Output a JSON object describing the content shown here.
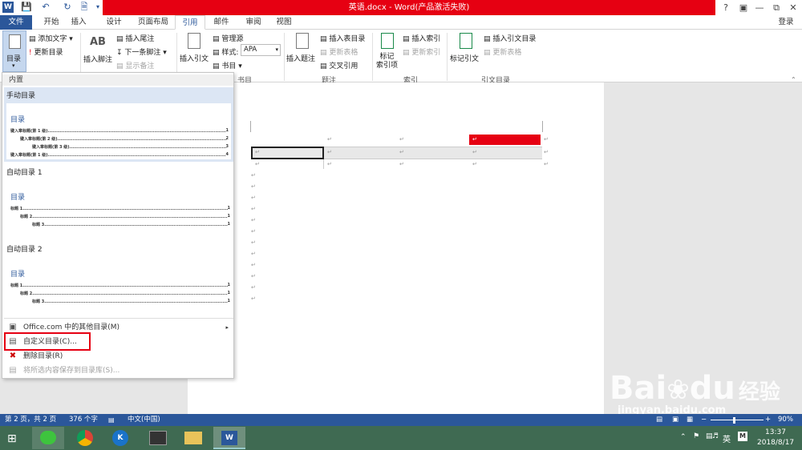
{
  "window": {
    "title": "英语.docx - Word(产品激活失败)",
    "help": "?",
    "login": "登录"
  },
  "tabs": [
    "文件",
    "开始",
    "插入",
    "设计",
    "页面布局",
    "引用",
    "邮件",
    "审阅",
    "视图"
  ],
  "ribbon": {
    "toc_button": "目录",
    "add_text": "添加文字",
    "update_toc": "更新目录",
    "insert_footnote": "插入脚注",
    "insert_endnote": "插入尾注",
    "next_footnote": "下一条脚注",
    "show_notes": "显示备注",
    "insert_citation": "插入引文",
    "manage_sources": "管理源",
    "style_label": "样式:",
    "style_value": "APA",
    "bibliography": "书目",
    "group_citations": "书目",
    "insert_caption": "插入题注",
    "insert_table_of_figures": "插入表目录",
    "update_table": "更新表格",
    "cross_reference": "交叉引用",
    "group_captions": "题注",
    "mark_entry": "标记\n索引项",
    "insert_index": "插入索引",
    "update_index": "更新索引",
    "group_index": "索引",
    "mark_citation": "标记引文",
    "insert_table_of_authorities": "插入引文目录",
    "update_table_auth": "更新表格",
    "group_toa": "引文目录",
    "ab_icon": "AB"
  },
  "dropdown": {
    "builtin": "内置",
    "manual_toc": "手动目录",
    "auto_toc_1": "自动目录 1",
    "auto_toc_2": "自动目录 2",
    "preview_title": "目录",
    "manual_lines": [
      {
        "text": "键入章标题(第 1 级)",
        "page": "1"
      },
      {
        "text": "键入章标题(第 2 级)",
        "page": "2"
      },
      {
        "text": "键入章标题(第 3 级)",
        "page": "3"
      },
      {
        "text": "键入章标题(第 1 级)",
        "page": "4"
      }
    ],
    "auto_lines": [
      {
        "text": "标题 1",
        "page": "1"
      },
      {
        "text": "标题 2",
        "page": "1"
      },
      {
        "text": "标题 3",
        "page": "1"
      }
    ],
    "menu": {
      "office_more": "Office.com 中的其他目录(M)",
      "custom_toc": "自定义目录(C)...",
      "remove_toc": "删除目录(R)",
      "save_selection": "将所选内容保存到目录库(S)..."
    }
  },
  "status": {
    "page": "第 2 页，共 2 页",
    "words": "376 个字",
    "language": "中文(中国)",
    "zoom": "90%"
  },
  "taskbar": {
    "ime": "英",
    "time": "13:37",
    "date": "2018/8/17"
  },
  "watermark": {
    "brand": "Bai",
    "brand2": "du",
    "brand_cn": "经验",
    "url": "jingyan.baidu.com"
  },
  "colors": {
    "word_blue": "#2b579a",
    "title_red": "#e60012",
    "highlight_red": "#cc0000"
  }
}
